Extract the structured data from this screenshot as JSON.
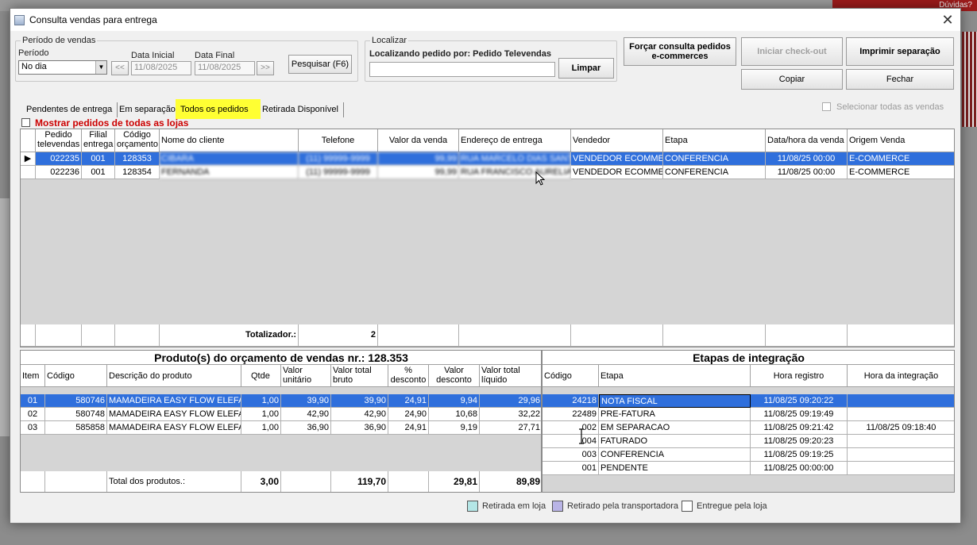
{
  "window": {
    "title": "Consulta vendas para entrega",
    "close_glyph": "✕"
  },
  "background": {
    "duvidas": "Dúvidas?"
  },
  "periodo_group": {
    "title": "Período de vendas",
    "periodo_label": "Período",
    "periodo_value": "No dia",
    "data_inicial_label": "Data Inicial",
    "data_inicial_value": "11/08/2025",
    "data_final_label": "Data Final",
    "data_final_value": "11/08/2025",
    "prev_label": "<<",
    "next_label": ">>",
    "pesquisar_label": "Pesquisar (F6)"
  },
  "localizar_group": {
    "title": "Localizar",
    "info": "Localizando pedido por: Pedido Televendas",
    "search_value": "",
    "limpar_label": "Limpar"
  },
  "actions": {
    "forcar_label": "Forçar consulta pedidos e-commerces",
    "iniciar_label": "Iniciar check-out",
    "imprimir_label": "Imprimir separação",
    "copiar_label": "Copiar",
    "fechar_label": "Fechar"
  },
  "tabs": [
    {
      "label": "Pendentes de entrega"
    },
    {
      "label": "Em separação"
    },
    {
      "label": "Todos os pedidos"
    },
    {
      "label": "Retirada Disponível"
    }
  ],
  "selecionar_todas": "Selecionar todas as vendas",
  "mostrar_todas_lojas": "Mostrar pedidos de todas as lojas",
  "orders": {
    "columns": {
      "pedido": "Pedido televendas",
      "filial": "Filial entrega",
      "codigo": "Código orçamento",
      "cliente": "Nome do cliente",
      "telefone": "Telefone",
      "valor": "Valor da venda",
      "endereco": "Endereço de entrega",
      "vendedor": "Vendedor",
      "etapa": "Etapa",
      "data": "Data/hora da venda",
      "origem": "Origem Venda"
    },
    "rows": [
      {
        "pedido": "022235",
        "filial": "001",
        "codigo": "128353",
        "cliente": "CIBARA",
        "telefone": "(11) 99999-9999",
        "valor": "99,99",
        "endereco": "RUA MARCELO DIAS SANT",
        "vendedor": "VENDEDOR ECOMME",
        "etapa": "CONFERENCIA",
        "data": "11/08/25 00:00",
        "origem": "E-COMMERCE"
      },
      {
        "pedido": "022236",
        "filial": "001",
        "codigo": "128354",
        "cliente": "FERNANDA",
        "telefone": "(11) 99999-9999",
        "valor": "99,99",
        "endereco": "RUA FRANCISCO AURELIA",
        "vendedor": "VENDEDOR ECOMME",
        "etapa": "CONFERENCIA",
        "data": "11/08/25 00:00",
        "origem": "E-COMMERCE"
      }
    ],
    "totalizador_label": "Totalizador.:",
    "totalizador_value": "2"
  },
  "produtos": {
    "title": "Produto(s) do orçamento de vendas nr.: 128.353",
    "columns": {
      "item": "Item",
      "codigo": "Código",
      "descricao": "Descrição do produto",
      "qtde": "Qtde",
      "valor_unitario": "Valor unitário",
      "valor_bruto": "Valor total bruto",
      "pct_desconto": "% desconto",
      "valor_desconto": "Valor desconto",
      "valor_liquido": "Valor total líquido"
    },
    "rows": [
      {
        "item": "01",
        "codigo": "580746",
        "descricao": "MAMADEIRA EASY FLOW ELEFA",
        "qtde": "1,00",
        "valor_unitario": "39,90",
        "valor_bruto": "39,90",
        "pct_desconto": "24,91",
        "valor_desconto": "9,94",
        "valor_liquido": "29,96"
      },
      {
        "item": "02",
        "codigo": "580748",
        "descricao": "MAMADEIRA EASY FLOW ELEFA",
        "qtde": "1,00",
        "valor_unitario": "42,90",
        "valor_bruto": "42,90",
        "pct_desconto": "24,90",
        "valor_desconto": "10,68",
        "valor_liquido": "32,22"
      },
      {
        "item": "03",
        "codigo": "585858",
        "descricao": "MAMADEIRA EASY FLOW ELEFA",
        "qtde": "1,00",
        "valor_unitario": "36,90",
        "valor_bruto": "36,90",
        "pct_desconto": "24,91",
        "valor_desconto": "9,19",
        "valor_liquido": "27,71"
      }
    ],
    "total_label": "Total dos produtos.:",
    "total_qtde": "3,00",
    "total_bruto": "119,70",
    "total_desconto": "29,81",
    "total_liquido": "89,89"
  },
  "etapas": {
    "title": "Etapas de integração",
    "columns": {
      "codigo": "Código",
      "etapa": "Etapa",
      "hora_registro": "Hora registro",
      "hora_integracao": "Hora da integração"
    },
    "rows": [
      {
        "codigo": "24218",
        "etapa": "NOTA FISCAL",
        "hora_registro": "11/08/25 09:20:22",
        "hora_integracao": ""
      },
      {
        "codigo": "22489",
        "etapa": "PRE-FATURA",
        "hora_registro": "11/08/25 09:19:49",
        "hora_integracao": ""
      },
      {
        "codigo": "002",
        "etapa": "EM SEPARACAO",
        "hora_registro": "11/08/25 09:21:42",
        "hora_integracao": "11/08/25 09:18:40"
      },
      {
        "codigo": "004",
        "etapa": "FATURADO",
        "hora_registro": "11/08/25 09:20:23",
        "hora_integracao": ""
      },
      {
        "codigo": "003",
        "etapa": "CONFERENCIA",
        "hora_registro": "11/08/25 09:19:25",
        "hora_integracao": ""
      },
      {
        "codigo": "001",
        "etapa": "PENDENTE",
        "hora_registro": "11/08/25 00:00:00",
        "hora_integracao": ""
      }
    ]
  },
  "legend": [
    {
      "label": "Retirada em loja",
      "color": "#b4e6e6"
    },
    {
      "label": "Retirado pela transportadora",
      "color": "#b9b4e6"
    },
    {
      "label": "Entregue pela loja",
      "color": "#ffffff"
    }
  ],
  "colors": {
    "selection": "#2f6fdc",
    "active_tab": "#ffff33",
    "alert_text": "#cc0000"
  }
}
